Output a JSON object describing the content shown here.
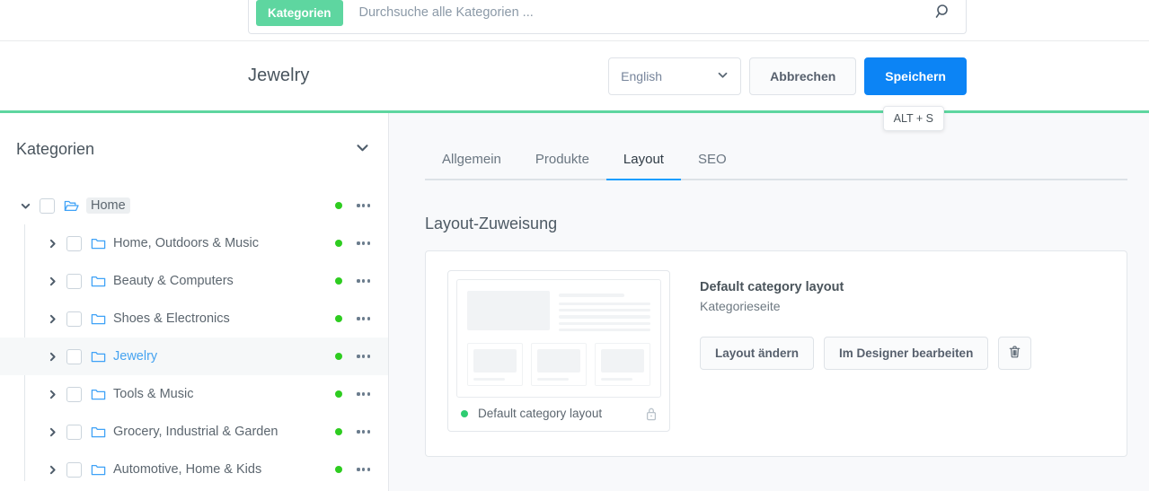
{
  "search": {
    "chip_label": "Kategorien",
    "placeholder": "Durchsuche alle Kategorien ...",
    "search_icon": "search-icon"
  },
  "header": {
    "title": "Jewelry",
    "language_value": "English",
    "cancel_label": "Abbrechen",
    "save_label": "Speichern",
    "save_tooltip": "ALT + S",
    "accent_color": "#0c84f5",
    "progress_color": "#5ed6a0"
  },
  "sidebar": {
    "title": "Kategorien",
    "collapse_icon": "chevron-down-icon",
    "tree": [
      {
        "label": "Home",
        "level": 0,
        "expanded": true,
        "icon": "folder-open-icon",
        "selected": false,
        "highlighted": true,
        "status": "active"
      },
      {
        "label": "Home, Outdoors & Music",
        "level": 1,
        "expanded": false,
        "icon": "folder-icon",
        "selected": false,
        "highlighted": false,
        "status": "active"
      },
      {
        "label": "Beauty & Computers",
        "level": 1,
        "expanded": false,
        "icon": "folder-icon",
        "selected": false,
        "highlighted": false,
        "status": "active"
      },
      {
        "label": "Shoes & Electronics",
        "level": 1,
        "expanded": false,
        "icon": "folder-icon",
        "selected": false,
        "highlighted": false,
        "status": "active"
      },
      {
        "label": "Jewelry",
        "level": 1,
        "expanded": false,
        "icon": "folder-icon",
        "selected": true,
        "highlighted": false,
        "status": "active"
      },
      {
        "label": "Tools & Music",
        "level": 1,
        "expanded": false,
        "icon": "folder-icon",
        "selected": false,
        "highlighted": false,
        "status": "active"
      },
      {
        "label": "Grocery, Industrial & Garden",
        "level": 1,
        "expanded": false,
        "icon": "folder-icon",
        "selected": false,
        "highlighted": false,
        "status": "active"
      },
      {
        "label": "Automotive, Home & Kids",
        "level": 1,
        "expanded": false,
        "icon": "folder-icon",
        "selected": false,
        "highlighted": false,
        "status": "active"
      }
    ],
    "status_dot_color": "#2ecc20"
  },
  "main": {
    "tabs": [
      {
        "label": "Allgemein",
        "active": false
      },
      {
        "label": "Produkte",
        "active": false
      },
      {
        "label": "Layout",
        "active": true
      },
      {
        "label": "SEO",
        "active": false
      }
    ],
    "section_title": "Layout-Zuweisung",
    "layout": {
      "name": "Default category layout",
      "type": "Kategorieseite",
      "change_button": "Layout ändern",
      "designer_button": "Im Designer bearbeiten",
      "delete_icon": "trash-icon",
      "thumb_name": "Default category layout",
      "thumb_status_color": "#2ecc71",
      "lock_icon": "lock-icon"
    }
  }
}
